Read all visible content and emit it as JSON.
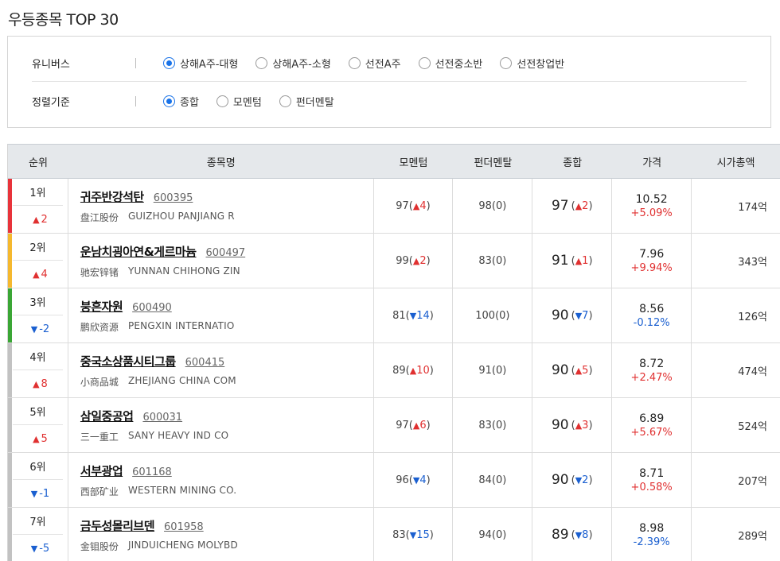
{
  "page_title": "우등종목 TOP 30",
  "filters": {
    "universe": {
      "label": "유니버스",
      "options": [
        "상해A주-대형",
        "상해A주-소형",
        "선전A주",
        "선전중소반",
        "선전창업반"
      ],
      "selected": 0
    },
    "sort": {
      "label": "정렬기준",
      "options": [
        "종합",
        "모멘텀",
        "펀더멘탈"
      ],
      "selected": 0
    }
  },
  "colors": {
    "up": "#e03030",
    "down": "#1a5fd0",
    "accent": "#1a73e8",
    "bar_red": "#e8333a",
    "bar_yellow": "#f5b82e",
    "bar_green": "#3aa635",
    "bar_gray": "#c2c2c2"
  },
  "table": {
    "headers": {
      "rank": "순위",
      "name": "종목명",
      "momentum": "모멘텀",
      "fundamental": "펀더멘탈",
      "total": "종합",
      "price": "가격",
      "cap": "시가총액"
    },
    "rows": [
      {
        "rank": "1위",
        "rank_change": "2",
        "rank_dir": "up",
        "bar": "red",
        "name": "귀주반강석탄",
        "code": "600395",
        "name_cn": "盘江股份",
        "name_en": "GUIZHOU PANJIANG R",
        "mom": "97",
        "mom_chg": "4",
        "mom_dir": "up",
        "fund": "98",
        "fund_chg": "0",
        "fund_dir": "none",
        "total": "97",
        "total_chg": "2",
        "total_dir": "up",
        "price": "10.52",
        "price_chg": "+5.09%",
        "price_dir": "up",
        "cap": "174억"
      },
      {
        "rank": "2위",
        "rank_change": "4",
        "rank_dir": "up",
        "bar": "yellow",
        "name": "운남치굉아연&게르마늄",
        "code": "600497",
        "name_cn": "驰宏锌锗",
        "name_en": "YUNNAN CHIHONG ZIN",
        "mom": "99",
        "mom_chg": "2",
        "mom_dir": "up",
        "fund": "83",
        "fund_chg": "0",
        "fund_dir": "none",
        "total": "91",
        "total_chg": "1",
        "total_dir": "up",
        "price": "7.96",
        "price_chg": "+9.94%",
        "price_dir": "up",
        "cap": "343억"
      },
      {
        "rank": "3위",
        "rank_change": "-2",
        "rank_dir": "down",
        "bar": "green",
        "name": "붕흔자원",
        "code": "600490",
        "name_cn": "鹏欣资源",
        "name_en": "PENGXIN INTERNATIO",
        "mom": "81",
        "mom_chg": "14",
        "mom_dir": "down",
        "fund": "100",
        "fund_chg": "0",
        "fund_dir": "none",
        "total": "90",
        "total_chg": "7",
        "total_dir": "down",
        "price": "8.56",
        "price_chg": "-0.12%",
        "price_dir": "down",
        "cap": "126억"
      },
      {
        "rank": "4위",
        "rank_change": "8",
        "rank_dir": "up",
        "bar": "gray",
        "name": "중국소상품시티그룹",
        "code": "600415",
        "name_cn": "小商品城",
        "name_en": "ZHEJIANG CHINA COM",
        "mom": "89",
        "mom_chg": "10",
        "mom_dir": "up",
        "fund": "91",
        "fund_chg": "0",
        "fund_dir": "none",
        "total": "90",
        "total_chg": "5",
        "total_dir": "up",
        "price": "8.72",
        "price_chg": "+2.47%",
        "price_dir": "up",
        "cap": "474억"
      },
      {
        "rank": "5위",
        "rank_change": "5",
        "rank_dir": "up",
        "bar": "gray",
        "name": "삼일중공업",
        "code": "600031",
        "name_cn": "三一重工",
        "name_en": "SANY HEAVY IND CO",
        "mom": "97",
        "mom_chg": "6",
        "mom_dir": "up",
        "fund": "83",
        "fund_chg": "0",
        "fund_dir": "none",
        "total": "90",
        "total_chg": "3",
        "total_dir": "up",
        "price": "6.89",
        "price_chg": "+5.67%",
        "price_dir": "up",
        "cap": "524억"
      },
      {
        "rank": "6위",
        "rank_change": "-1",
        "rank_dir": "down",
        "bar": "gray",
        "name": "서부광업",
        "code": "601168",
        "name_cn": "西部矿业",
        "name_en": "WESTERN MINING CO.",
        "mom": "96",
        "mom_chg": "4",
        "mom_dir": "down",
        "fund": "84",
        "fund_chg": "0",
        "fund_dir": "none",
        "total": "90",
        "total_chg": "2",
        "total_dir": "down",
        "price": "8.71",
        "price_chg": "+0.58%",
        "price_dir": "up",
        "cap": "207억"
      },
      {
        "rank": "7위",
        "rank_change": "-5",
        "rank_dir": "down",
        "bar": "gray",
        "name": "금두성몰리브덴",
        "code": "601958",
        "name_cn": "金钼股份",
        "name_en": "JINDUICHENG MOLYBD",
        "mom": "83",
        "mom_chg": "15",
        "mom_dir": "down",
        "fund": "94",
        "fund_chg": "0",
        "fund_dir": "none",
        "total": "89",
        "total_chg": "8",
        "total_dir": "down",
        "price": "8.98",
        "price_chg": "-2.39%",
        "price_dir": "down",
        "cap": "289억"
      }
    ]
  }
}
